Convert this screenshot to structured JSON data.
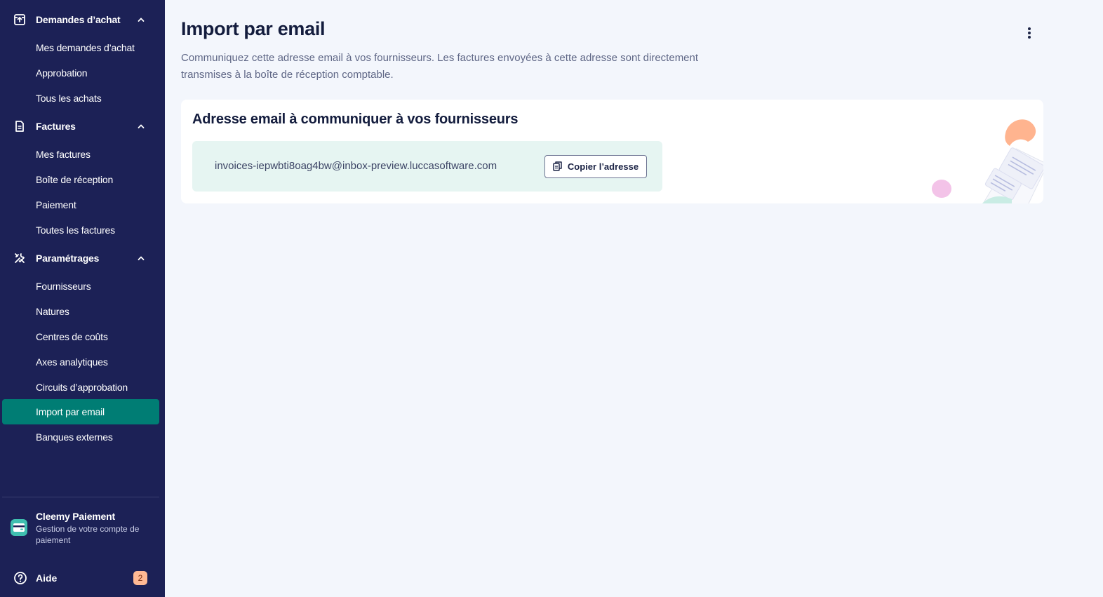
{
  "sidebar": {
    "sections": [
      {
        "label": "Demandes d’achat",
        "icon": "upload-box-icon",
        "items": [
          "Mes demandes d’achat",
          "Approbation",
          "Tous les achats"
        ]
      },
      {
        "label": "Factures",
        "icon": "document-icon",
        "items": [
          "Mes factures",
          "Boîte de réception",
          "Paiement",
          "Toutes les factures"
        ]
      },
      {
        "label": "Paramétrages",
        "icon": "tools-icon",
        "items": [
          "Fournisseurs",
          "Natures",
          "Centres de coûts",
          "Axes analytiques",
          "Circuits d’approbation",
          "Import par email",
          "Banques externes"
        ]
      }
    ],
    "active_item": "Import par email",
    "cleemy": {
      "title": "Cleemy Paiement",
      "subtitle": "Gestion de votre compte de paiement"
    },
    "help": {
      "label": "Aide",
      "badge": "2"
    }
  },
  "main": {
    "title": "Import par email",
    "description": "Communiquez cette adresse email à vos fournisseurs. Les factures envoyées à cette adresse sont directement transmises à la boîte de réception comptable.",
    "card": {
      "title": "Adresse email à communiquer à vos fournisseurs",
      "email": "invoices-iepwbti8oag4bw@inbox-preview.luccasoftware.com",
      "copy_label": "Copier l’adresse"
    }
  },
  "colors": {
    "sidebar_bg": "#1c2156",
    "active_bg": "#007d74",
    "page_bg": "#f3f6fc",
    "email_box_bg": "#e6f5f2",
    "badge_bg": "#ffb994"
  }
}
